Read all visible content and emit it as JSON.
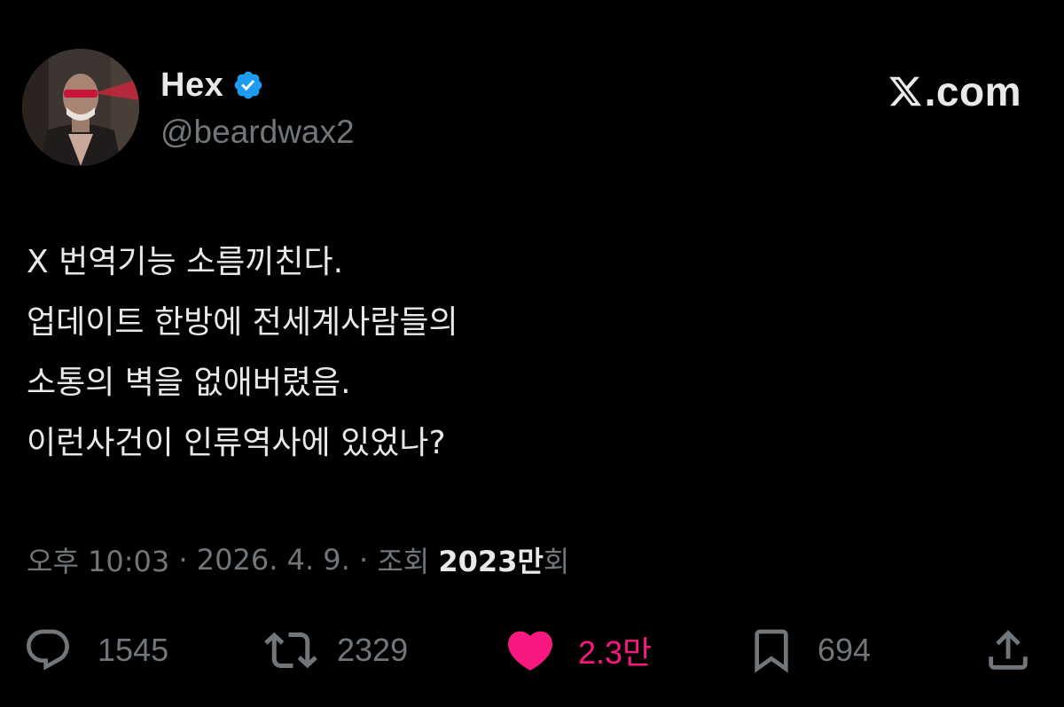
{
  "tweet": {
    "author": {
      "display_name": "Hex",
      "handle": "@beardwax2",
      "verified": true
    },
    "brand": {
      "text": ".com",
      "icon": "x-logo-icon"
    },
    "text_lines": [
      "X 번역기능 소름끼친다.",
      "업데이트 한방에 전세계사람들의",
      "소통의 벽을 없애버렸음.",
      "이런사건이 인류역사에 있었나?"
    ],
    "meta": {
      "time": "오후 10:03",
      "date": "2026. 4. 9.",
      "separator": " · ",
      "views_label": "조회 ",
      "views_count": "2023만",
      "views_suffix": "회"
    },
    "actions": {
      "replies": {
        "icon": "reply-icon",
        "count": "1545"
      },
      "reposts": {
        "icon": "repost-icon",
        "count": "2329"
      },
      "likes": {
        "icon": "heart-icon",
        "count": "2.3만",
        "liked": true
      },
      "bookmarks": {
        "icon": "bookmark-icon",
        "count": "694"
      },
      "share": {
        "icon": "share-icon"
      }
    },
    "colors": {
      "background": "#000000",
      "text_primary": "#e7e9ea",
      "text_secondary": "#71767b",
      "verified_blue": "#1d9bf0",
      "like_pink": "#f91880"
    }
  }
}
